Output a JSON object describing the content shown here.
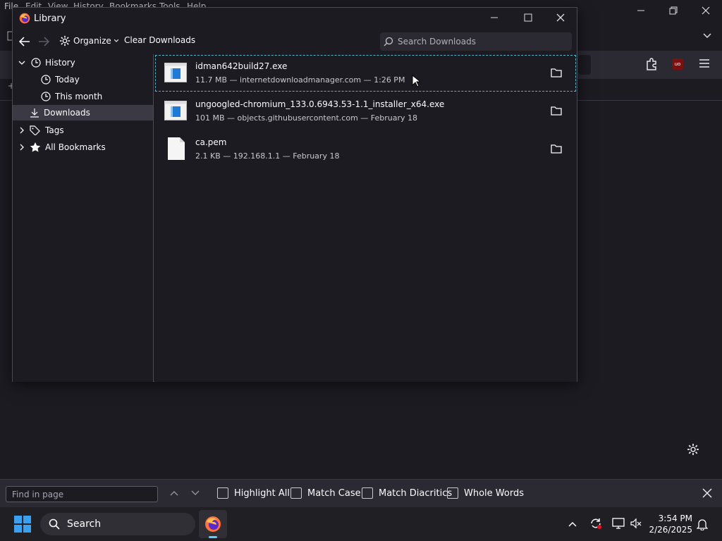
{
  "browser": {
    "menu": [
      "File",
      "Edit",
      "View",
      "History",
      "Bookmarks",
      "Tools",
      "Help"
    ],
    "ublock_badge": "uo"
  },
  "library": {
    "title": "Library",
    "toolbar": {
      "organize_label": "Organize",
      "clear_label": "Clear Downloads",
      "search_placeholder": "Search Downloads"
    },
    "sidebar": [
      {
        "label": "History",
        "expanded": true,
        "level": 0,
        "icon": "clock-icon"
      },
      {
        "label": "Today",
        "level": 1,
        "icon": "clock-icon"
      },
      {
        "label": "This month",
        "level": 1,
        "icon": "clock-icon"
      },
      {
        "label": "Downloads",
        "level": 0,
        "selected": true,
        "icon": "download-icon"
      },
      {
        "label": "Tags",
        "expanded": false,
        "level": 0,
        "icon": "tag-icon"
      },
      {
        "label": "All Bookmarks",
        "expanded": false,
        "level": 0,
        "icon": "star-icon"
      }
    ],
    "downloads": [
      {
        "name": "idman642build27.exe",
        "meta": "11.7 MB — internetdownloadmanager.com — 1:26 PM",
        "icon": "exe-file-icon"
      },
      {
        "name": "ungoogled-chromium_133.0.6943.53-1.1_installer_x64.exe",
        "meta": "101 MB — objects.githubusercontent.com — February 18",
        "icon": "exe-file-icon"
      },
      {
        "name": "ca.pem",
        "meta": "2.1 KB — 192.168.1.1 — February 18",
        "icon": "generic-file-icon"
      }
    ]
  },
  "findbar": {
    "placeholder": "Find in page",
    "options": [
      "Highlight All",
      "Match Case",
      "Match Diacritics",
      "Whole Words"
    ]
  },
  "taskbar": {
    "search_label": "Search",
    "time": "3:54 PM",
    "date": "2/26/2025"
  },
  "colors": {
    "accent_focus": "#56b4c8",
    "window_bg": "#1c1b22",
    "toolbar_bg": "#2b2a33"
  }
}
